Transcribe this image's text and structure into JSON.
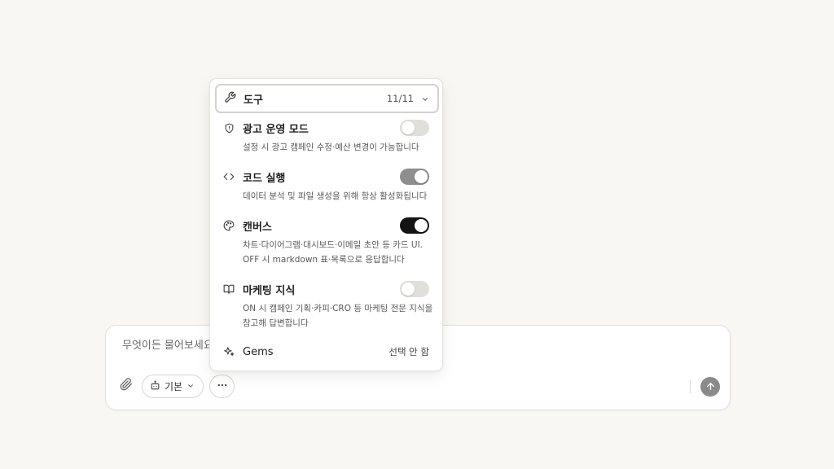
{
  "composer": {
    "placeholder": "무엇이든 물어보세요",
    "mode_label": "기본",
    "icons": {
      "attach": "paperclip-icon",
      "mode": "bot-icon",
      "mode_chevron": "chevron-down-icon",
      "more": "more-horizontal-icon",
      "send": "arrow-up-icon"
    },
    "send_color": "#8a8a8a"
  },
  "tools_menu": {
    "header": {
      "label": "도구",
      "count": "11/11",
      "icon": "tools-icon",
      "chevron": "chevron-down-icon"
    },
    "items": [
      {
        "title": "광고 운영 모드",
        "desc": "설정 시 광고 캠페인 수정·예산 변경이 가능합니다",
        "icon": "shield-icon",
        "toggle": "off"
      },
      {
        "title": "코드 실행",
        "desc": "데이터 분석 및 파일 생성을 위해 항상 활성화됩니다",
        "icon": "code-icon",
        "toggle": "on-disabled"
      },
      {
        "title": "캔버스",
        "desc": "차트·다이어그램·대시보드·이메일 초안 등 카드 UI. OFF 시 markdown 표·목록으로 응답합니다",
        "icon": "palette-icon",
        "toggle": "on"
      },
      {
        "title": "마케팅 지식",
        "desc": "ON 시 캠페인 기획·카피·CRO 등 마케팅 전문 지식을 참고해 답변합니다",
        "icon": "book-icon",
        "toggle": "off"
      }
    ],
    "gems": {
      "title": "Gems",
      "status": "선택 안 함",
      "icon": "sparkles-icon"
    }
  },
  "colors": {
    "background": "#f8f7f4",
    "toggle_on": "#141414",
    "toggle_on_disabled": "#8e8e8e",
    "toggle_off": "#e0dfdc"
  }
}
